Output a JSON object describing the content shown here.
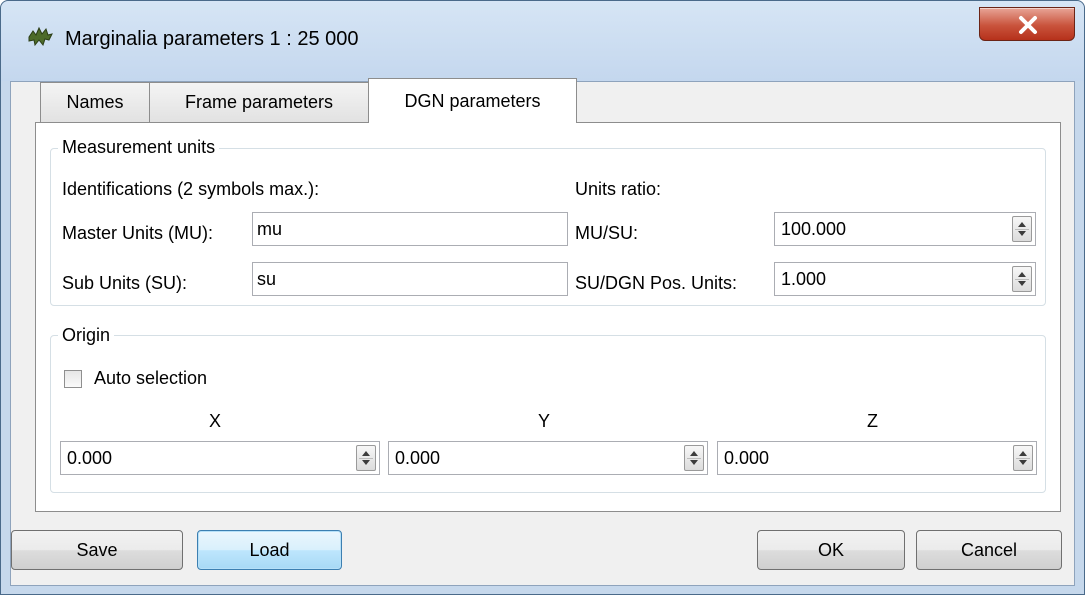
{
  "window": {
    "title": "Marginalia parameters 1 : 25 000"
  },
  "tabs": [
    {
      "label": "Names"
    },
    {
      "label": "Frame parameters"
    },
    {
      "label": "DGN parameters"
    }
  ],
  "measurement": {
    "group_title": "Measurement units",
    "identifications_label": "Identifications (2 symbols max.):",
    "units_ratio_label": "Units ratio:",
    "master_units_label": "Master Units (MU):",
    "master_units_value": "mu",
    "sub_units_label": "Sub Units (SU):",
    "sub_units_value": "su",
    "mu_su_label": "MU/SU:",
    "mu_su_value": "100.000",
    "su_dgn_label": "SU/DGN Pos. Units:",
    "su_dgn_value": "1.000"
  },
  "origin": {
    "group_title": "Origin",
    "auto_selection_label": "Auto selection",
    "auto_selection_checked": false,
    "x_label": "X",
    "y_label": "Y",
    "z_label": "Z",
    "x_value": "0.000",
    "y_value": "0.000",
    "z_value": "0.000"
  },
  "buttons": {
    "save": "Save",
    "load": "Load",
    "ok": "OK",
    "cancel": "Cancel"
  }
}
